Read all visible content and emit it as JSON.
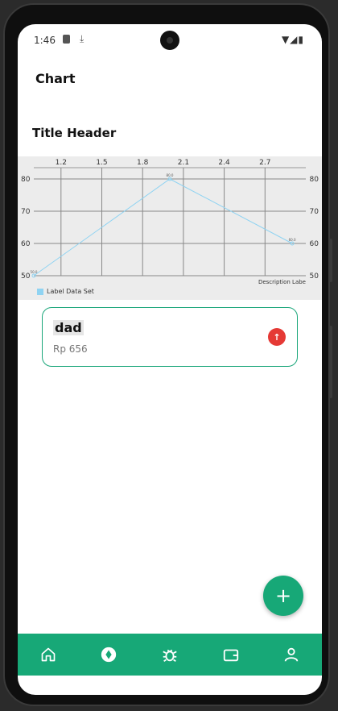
{
  "status_bar": {
    "time": "1:46",
    "download_icon": "download-icon",
    "right_icons": "▼◢▮"
  },
  "app_bar": {
    "title": "Chart"
  },
  "section": {
    "title": "Title Header"
  },
  "chart_data": {
    "type": "line",
    "x_ticks": [
      "1.2",
      "1.5",
      "1.8",
      "2.1",
      "2.4",
      "2.7"
    ],
    "y_ticks": [
      "80",
      "70",
      "60",
      "50"
    ],
    "ylim": [
      50,
      80
    ],
    "series": [
      {
        "name": "Label Data Set",
        "color": "#8fd3f2",
        "x": [
          1.0,
          2.0,
          2.9
        ],
        "y": [
          50,
          80,
          60
        ]
      }
    ],
    "point_labels": [
      "50.0",
      "80.0",
      "60.0"
    ],
    "legend_position": "bottom-left",
    "description": "Description Labe"
  },
  "card": {
    "name": "dad",
    "amount": "Rp 656",
    "action_icon": "arrow-up-icon"
  },
  "fab": {
    "label": "+"
  },
  "bottom_nav": {
    "items": [
      "home-icon",
      "currency-icon",
      "bug-icon",
      "wallet-icon",
      "person-icon"
    ],
    "accent": "#17a877"
  }
}
